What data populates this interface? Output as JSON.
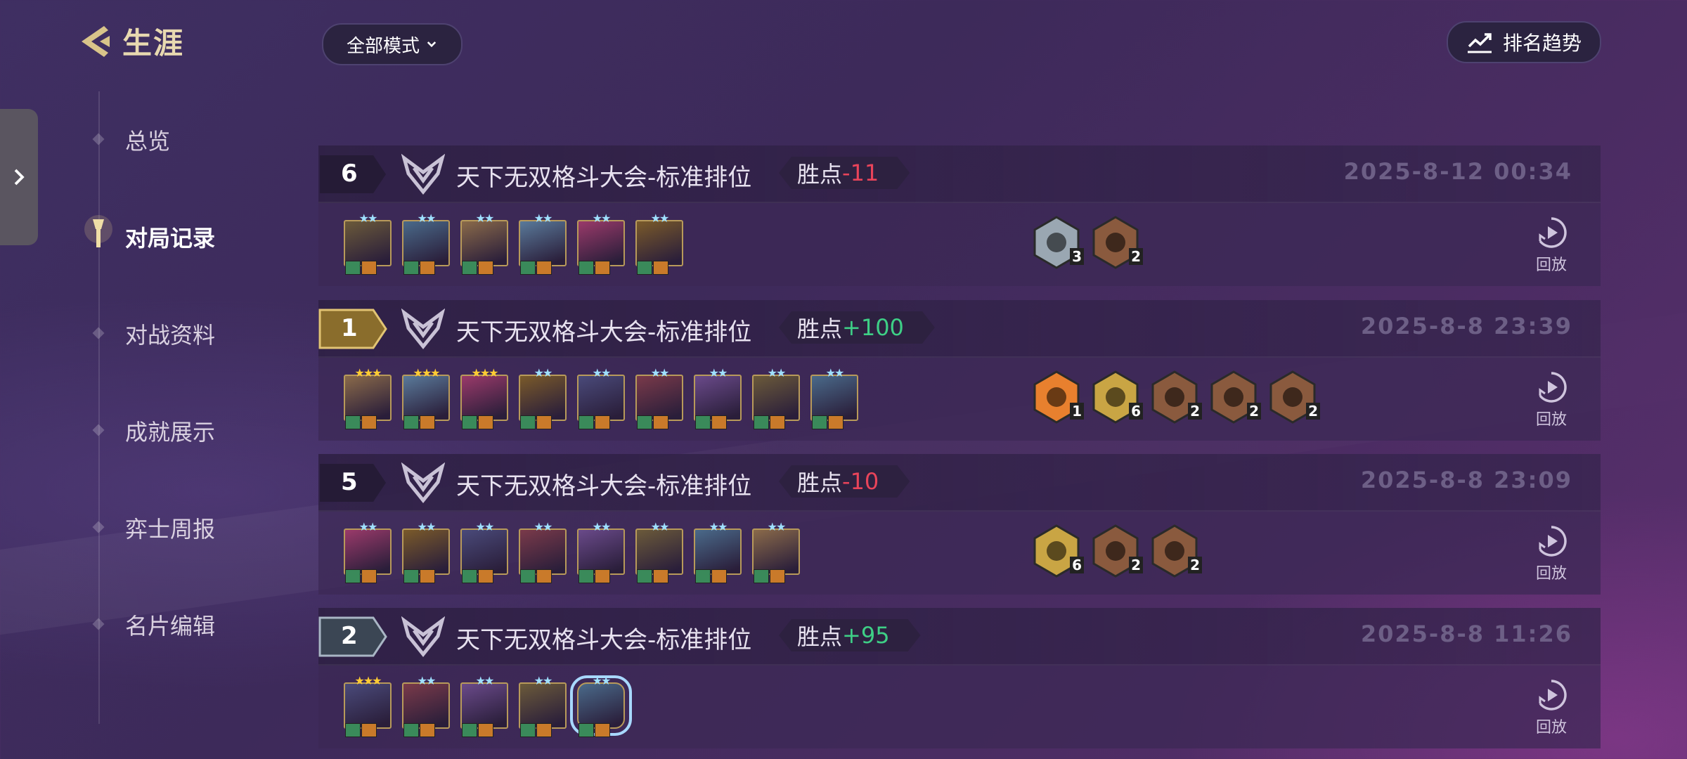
{
  "header": {
    "title": "生涯",
    "mode_filter": "全部模式",
    "trend_button": "排名趋势"
  },
  "nav": [
    "总览",
    "对局记录",
    "对战资料",
    "成就展示",
    "弈士周报",
    "名片编辑"
  ],
  "active_nav": "对局记录",
  "replay_label": "回放",
  "matches": [
    {
      "rank": "6",
      "mode": "天下无双格斗大会-标准排位",
      "points_label": "胜点",
      "points": "-11",
      "time": "2025-8-12 00:34",
      "champions": 6,
      "traits": [
        {
          "count": "3",
          "tier": "silver"
        },
        {
          "count": "2",
          "tier": "bronze"
        }
      ]
    },
    {
      "rank": "1",
      "mode": "天下无双格斗大会-标准排位",
      "points_label": "胜点",
      "points": "+100",
      "time": "2025-8-8 23:39",
      "champions": 9,
      "traits": [
        {
          "count": "1",
          "tier": "prismatic"
        },
        {
          "count": "6",
          "tier": "gold"
        },
        {
          "count": "2",
          "tier": "bronze"
        },
        {
          "count": "2",
          "tier": "bronze"
        },
        {
          "count": "2",
          "tier": "bronze"
        }
      ]
    },
    {
      "rank": "5",
      "mode": "天下无双格斗大会-标准排位",
      "points_label": "胜点",
      "points": "-10",
      "time": "2025-8-8 23:09",
      "champions": 8,
      "traits": [
        {
          "count": "6",
          "tier": "gold"
        },
        {
          "count": "2",
          "tier": "bronze"
        },
        {
          "count": "2",
          "tier": "bronze"
        }
      ]
    },
    {
      "rank": "2",
      "mode": "天下无双格斗大会-标准排位",
      "points_label": "胜点",
      "points": "+95",
      "time": "2025-8-8 11:26",
      "champions": 5,
      "traits": []
    }
  ],
  "colors": {
    "win_points": "#3ecf86",
    "loss_points": "#e9445a",
    "accent_gold": "#e8d9b0"
  }
}
